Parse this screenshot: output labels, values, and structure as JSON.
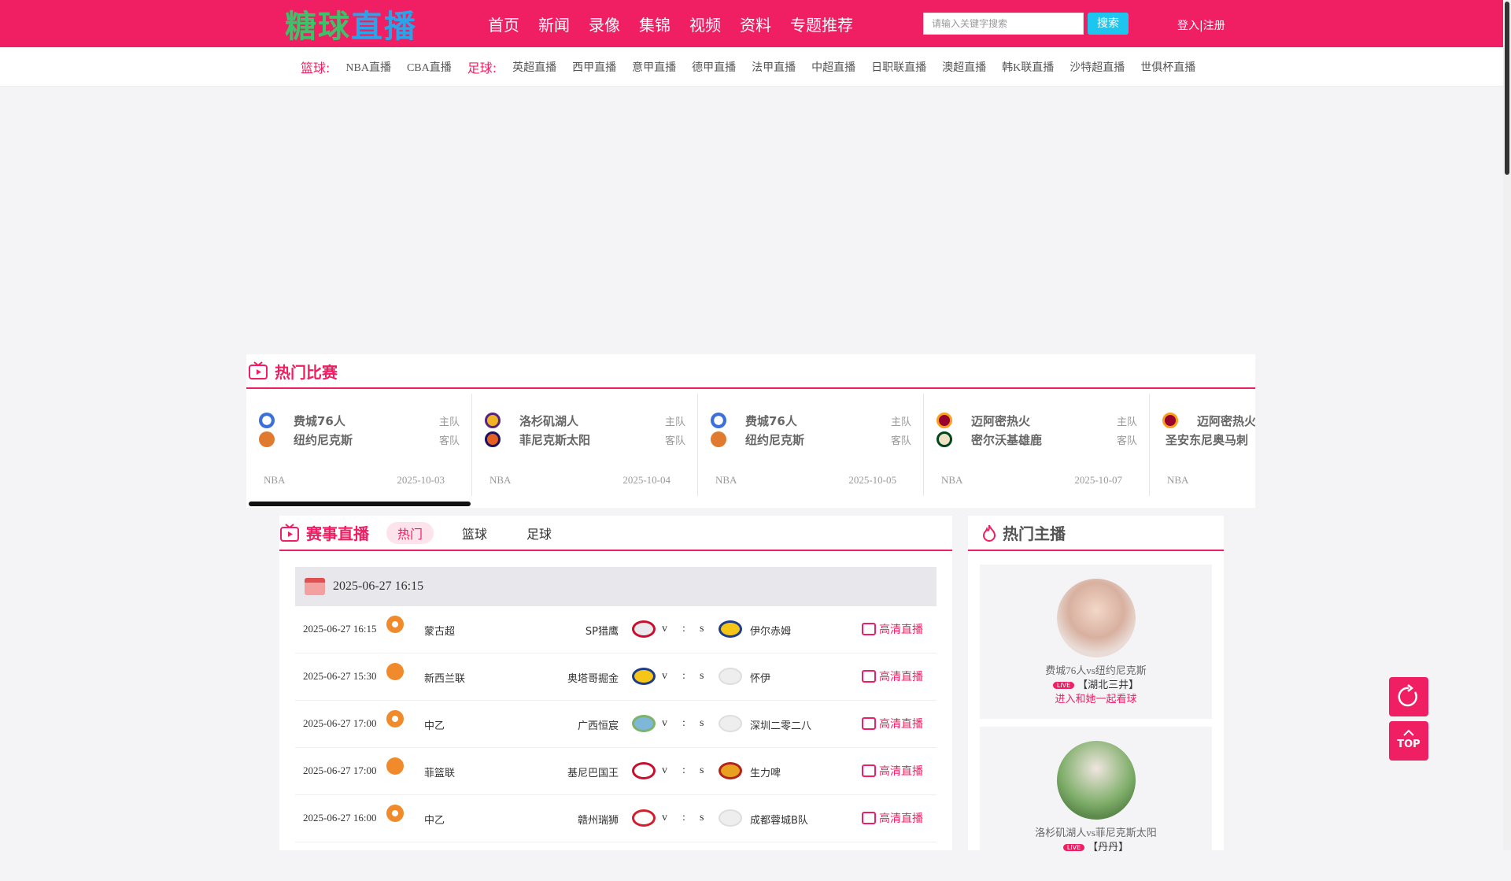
{
  "header": {
    "logo_text": "糖球直播",
    "nav": [
      "首页",
      "新闻",
      "录像",
      "集锦",
      "视频",
      "资料",
      "专题推荐"
    ],
    "search_placeholder": "请输入关键字搜索",
    "search_button": "搜索",
    "login": "登入|注册"
  },
  "subnav": {
    "basketball_label": "篮球:",
    "basketball_links": [
      "NBA直播",
      "CBA直播"
    ],
    "football_label": "足球:",
    "football_links": [
      "英超直播",
      "西甲直播",
      "意甲直播",
      "德甲直播",
      "法甲直播",
      "中超直播",
      "日职联直播",
      "澳超直播",
      "韩K联直播",
      "沙特超直播",
      "世俱杯直播"
    ]
  },
  "hot_matches": {
    "title": "热门比赛",
    "cards": [
      {
        "home": "费城76人",
        "home_role": "主队",
        "away": "纽约尼克斯",
        "away_role": "客队",
        "league": "NBA",
        "date": "2025-10-03"
      },
      {
        "home": "洛杉矶湖人",
        "home_role": "主队",
        "away": "菲尼克斯太阳",
        "away_role": "客队",
        "league": "NBA",
        "date": "2025-10-04"
      },
      {
        "home": "费城76人",
        "home_role": "主队",
        "away": "纽约尼克斯",
        "away_role": "客队",
        "league": "NBA",
        "date": "2025-10-05"
      },
      {
        "home": "迈阿密热火",
        "home_role": "主队",
        "away": "密尔沃基雄鹿",
        "away_role": "客队",
        "league": "NBA",
        "date": "2025-10-07"
      },
      {
        "home": "迈阿密热火",
        "home_role": "",
        "away": "圣安东尼奥马刺",
        "away_role": "",
        "league": "NBA",
        "date": ""
      }
    ]
  },
  "live": {
    "title": "赛事直播",
    "tabs": [
      "热门",
      "篮球",
      "足球"
    ],
    "date_header": "2025-06-27 16:15",
    "rows": [
      {
        "time": "2025-06-27 16:15",
        "sport": "football",
        "league": "蒙古超",
        "home": "SP猎鹰",
        "v": "v",
        "colon": ":",
        "s": "s",
        "away": "伊尔赤姆",
        "link": "高清直播"
      },
      {
        "time": "2025-06-27 15:30",
        "sport": "basketball",
        "league": "新西兰联",
        "home": "奥塔哥掘金",
        "v": "v",
        "colon": ":",
        "s": "s",
        "away": "怀伊",
        "link": "高清直播"
      },
      {
        "time": "2025-06-27 17:00",
        "sport": "football",
        "league": "中乙",
        "home": "广西恒宸",
        "v": "v",
        "colon": ":",
        "s": "s",
        "away": "深圳二零二八",
        "link": "高清直播"
      },
      {
        "time": "2025-06-27 17:00",
        "sport": "basketball",
        "league": "菲篮联",
        "home": "基尼巴国王",
        "v": "v",
        "colon": ":",
        "s": "s",
        "away": "生力啤",
        "link": "高清直播"
      },
      {
        "time": "2025-06-27 16:00",
        "sport": "football",
        "league": "中乙",
        "home": "赣州瑞狮",
        "v": "v",
        "colon": ":",
        "s": "s",
        "away": "成都蓉城B队",
        "link": "高清直播"
      }
    ]
  },
  "anchors": {
    "title": "热门主播",
    "live_badge": "LIVE",
    "cards": [
      {
        "match": "费城76人vs纽约尼克斯",
        "name": "【湖北三井】",
        "join": "进入和她一起看球"
      },
      {
        "match": "洛杉矶湖人vs菲尼克斯太阳",
        "name": "【丹丹】",
        "join": ""
      }
    ]
  },
  "floating": {
    "refresh_icon": "refresh-icon",
    "top_label": "TOP"
  },
  "colors": {
    "brand": "#f01e62",
    "search_button": "#1cc6ef"
  }
}
